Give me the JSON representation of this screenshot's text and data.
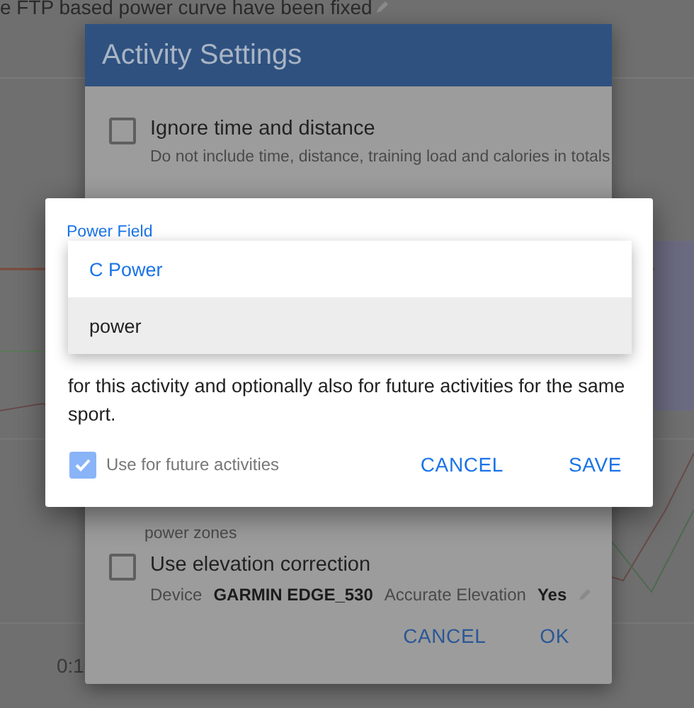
{
  "background": {
    "note": "e FTP based power curve have been fixed",
    "axis_labels": [
      "0:1"
    ]
  },
  "activity_settings": {
    "title": "Activity Settings",
    "options": [
      {
        "label": "Ignore time and distance",
        "description": "Do not include time, distance, training load and calories in totals",
        "checked": false
      },
      {
        "description": "power zones"
      },
      {
        "label": "Use elevation correction",
        "checked": false,
        "details": [
          {
            "label": "Device",
            "value": "GARMIN EDGE_530"
          },
          {
            "label": "Accurate Elevation",
            "value": "Yes"
          }
        ]
      }
    ],
    "buttons": [
      "CANCEL",
      "OK"
    ]
  },
  "power_dialog": {
    "field_label": "Power Field",
    "menu": [
      {
        "label": "C Power",
        "selected": true,
        "highlighted": false
      },
      {
        "label": "power",
        "selected": false,
        "highlighted": true
      }
    ],
    "text": "for this activity and optionally also for future activities for the same sport.",
    "future": {
      "label": "Use for future activities",
      "checked": true
    },
    "buttons": [
      "CANCEL",
      "SAVE"
    ]
  }
}
